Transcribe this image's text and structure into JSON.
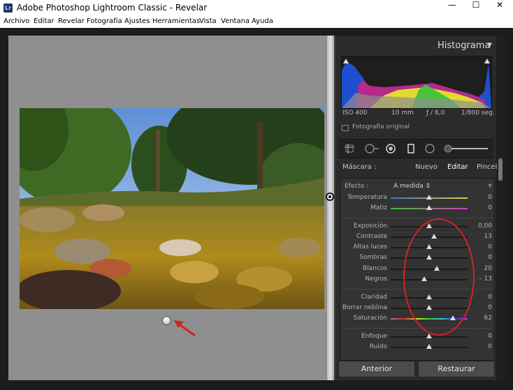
{
  "window": {
    "title": "Adobe Photoshop Lightroom Classic - Revelar",
    "app_badge": "Lr",
    "minimize": "—",
    "maximize": "☐",
    "close": "✕"
  },
  "menu": [
    "Archivo",
    "Editar",
    "Revelar",
    "Fotografía",
    "Ajustes",
    "Herramientas",
    "Vista",
    "Ventana",
    "Ayuda"
  ],
  "histogram": {
    "title": "Histograma",
    "iso": "ISO 400",
    "focal": "10 mm",
    "aperture": "ƒ / 8,0",
    "shutter": "1/800 seg.",
    "original_label": "Fotografía original"
  },
  "mask": {
    "label": "Máscara :",
    "nuevo": "Nuevo",
    "editar": "Editar",
    "pincel": "Pincel"
  },
  "effect": {
    "label": "Efecto :",
    "value": "A medida",
    "arrow": "⇕"
  },
  "sliders": [
    {
      "label": "Temperatura",
      "value": "0",
      "pos": 0.5
    },
    {
      "label": "Matiz",
      "value": "0",
      "pos": 0.5
    },
    {
      "label": "Exposición",
      "value": "0,00",
      "pos": 0.5
    },
    {
      "label": "Contraste",
      "value": "13",
      "pos": 0.565
    },
    {
      "label": "Altas luces",
      "value": "0",
      "pos": 0.5
    },
    {
      "label": "Sombras",
      "value": "0",
      "pos": 0.5
    },
    {
      "label": "Blancos",
      "value": "20",
      "pos": 0.6
    },
    {
      "label": "Negros",
      "value": "– 13",
      "pos": 0.435
    },
    {
      "label": "Claridad",
      "value": "0",
      "pos": 0.5
    },
    {
      "label": "Borrar neblina",
      "value": "0",
      "pos": 0.5
    },
    {
      "label": "Saturación",
      "value": "62",
      "pos": 0.81
    },
    {
      "label": "Enfoque",
      "value": "0",
      "pos": 0.5
    },
    {
      "label": "Ruido",
      "value": "0",
      "pos": 0.5
    }
  ],
  "buttons": {
    "anterior": "Anterior",
    "restaurar": "Restaurar"
  },
  "colors": {
    "annotation_red": "#d42222",
    "panel_bg": "#2b2b2b",
    "workspace_bg": "#8f8f8f"
  }
}
